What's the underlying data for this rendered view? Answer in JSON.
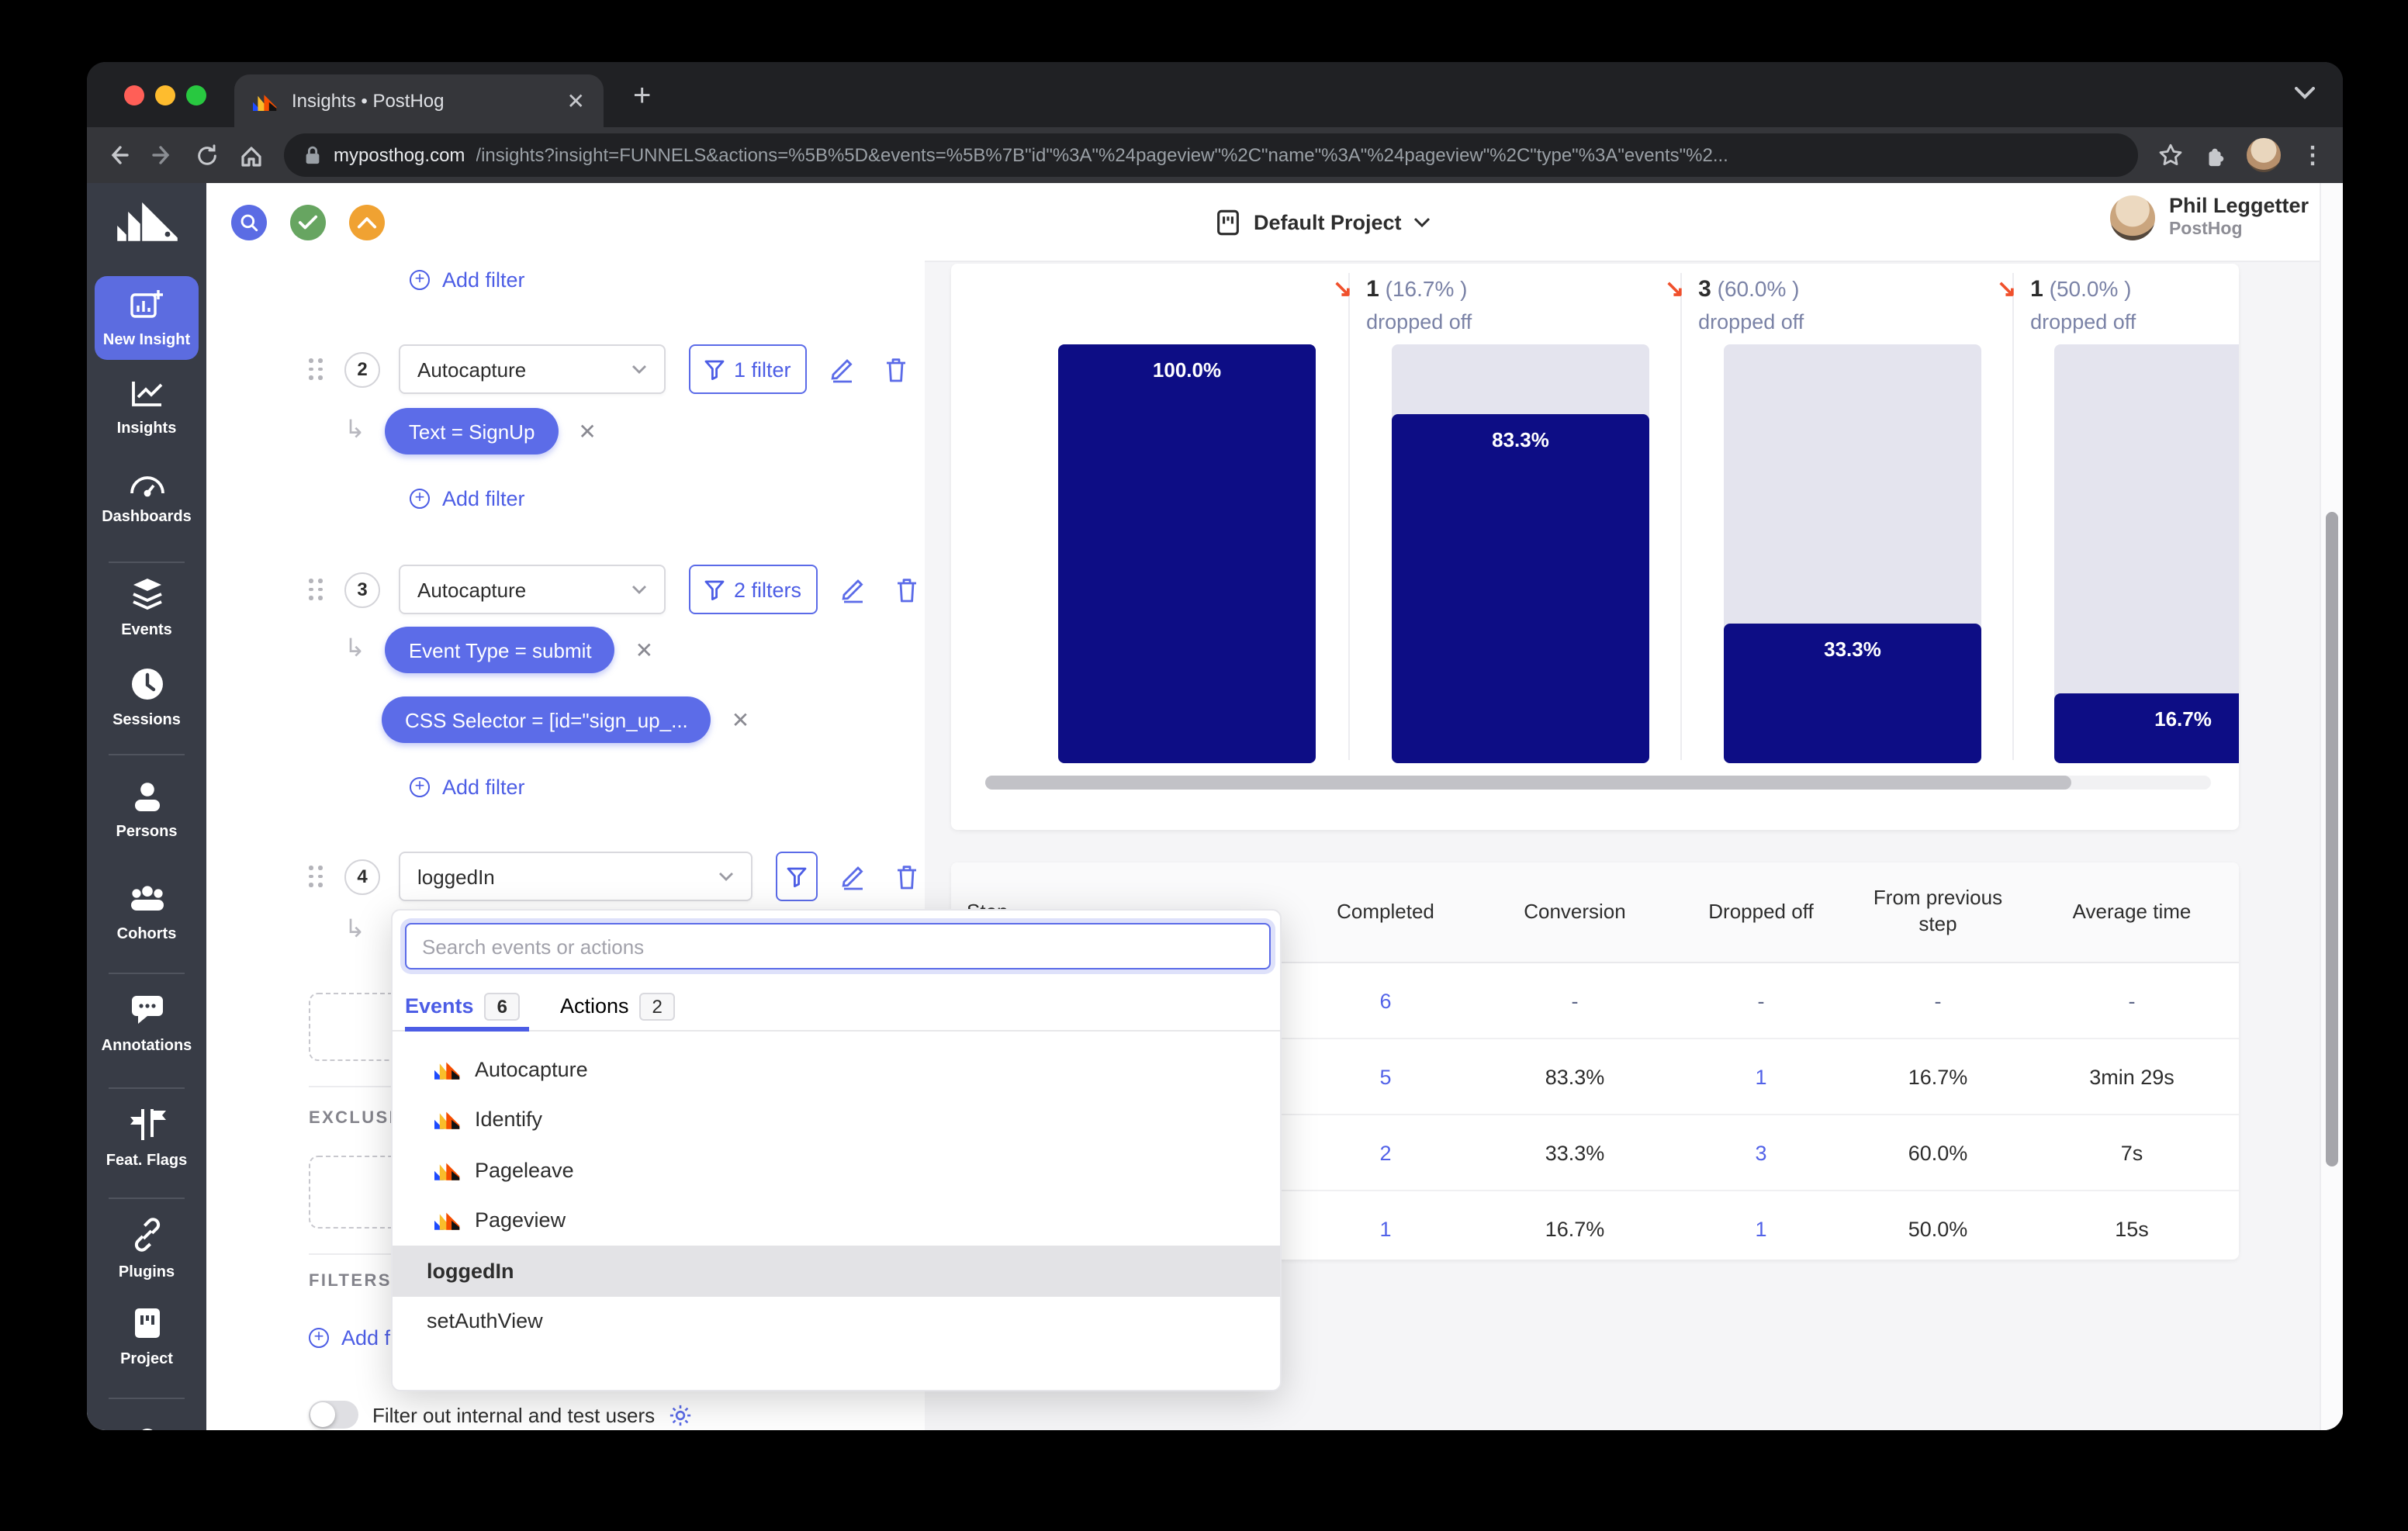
{
  "browser": {
    "tab_title": "Insights • PostHog",
    "url_host": "myposthog.com",
    "url_path": "/insights?insight=FUNNELS&actions=%5B%5D&events=%5B%7B\"id\"%3A\"%24pageview\"%2C\"name\"%3A\"%24pageview\"%2C\"type\"%3A\"events\"%2..."
  },
  "header": {
    "project_label": "Default Project",
    "user_name": "Phil Leggetter",
    "user_org": "PostHog"
  },
  "sidebar": {
    "items": [
      {
        "label": "New Insight"
      },
      {
        "label": "Insights"
      },
      {
        "label": "Dashboards"
      },
      {
        "label": "Events"
      },
      {
        "label": "Sessions"
      },
      {
        "label": "Persons"
      },
      {
        "label": "Cohorts"
      },
      {
        "label": "Annotations"
      },
      {
        "label": "Feat. Flags"
      },
      {
        "label": "Plugins"
      },
      {
        "label": "Project"
      }
    ]
  },
  "builder": {
    "add_filter_label": "Add filter",
    "steps": [
      {
        "num": "2",
        "event": "Autocapture",
        "filter_button": "1 filter",
        "pills": [
          {
            "text": "Text = SignUp"
          }
        ]
      },
      {
        "num": "3",
        "event": "Autocapture",
        "filter_button": "2 filters",
        "pills": [
          {
            "text": "Event Type = submit"
          },
          {
            "text": "CSS Selector = [id=\"sign_up_..."
          }
        ]
      },
      {
        "num": "4",
        "event": "loggedIn"
      }
    ],
    "exclusions_heading": "EXCLUSIONS",
    "filters_heading": "FILTERS",
    "toggle_label": "Filter out internal and test users"
  },
  "dropdown": {
    "search_placeholder": "Search events or actions",
    "tabs": [
      {
        "label": "Events",
        "count": "6"
      },
      {
        "label": "Actions",
        "count": "2"
      }
    ],
    "items": [
      {
        "label": "Autocapture"
      },
      {
        "label": "Identify"
      },
      {
        "label": "Pageleave"
      },
      {
        "label": "Pageview"
      },
      {
        "label": "loggedIn"
      },
      {
        "label": "setAuthView"
      }
    ]
  },
  "chart_data": {
    "type": "funnel",
    "steps": [
      {
        "label": "100.0%",
        "pct": 100
      },
      {
        "label": "83.3%",
        "pct": 83.3
      },
      {
        "label": "33.3%",
        "pct": 33.3
      },
      {
        "label": "16.7%",
        "pct": 16.7
      }
    ],
    "dropoffs": [
      {
        "count": "1",
        "pct": "(16.7% )",
        "label": "dropped off"
      },
      {
        "count": "3",
        "pct": "(60.0% )",
        "label": "dropped off"
      },
      {
        "count": "1",
        "pct": "(50.0% )",
        "label": "dropped off"
      }
    ],
    "colors": {
      "bar": "#0d0d85",
      "track": "#e4e4ee"
    }
  },
  "table": {
    "headers": [
      "Step",
      "Completed",
      "Conversion",
      "Dropped off",
      "From previous step",
      "Average time"
    ],
    "rows": [
      [
        "",
        "6",
        "-",
        "-",
        "-",
        "-"
      ],
      [
        "",
        "5",
        "83.3%",
        "1",
        "16.7%",
        "3min 29s"
      ],
      [
        "",
        "2",
        "33.3%",
        "3",
        "60.0%",
        "7s"
      ],
      [
        "",
        "1",
        "16.7%",
        "1",
        "50.0%",
        "15s"
      ]
    ]
  }
}
